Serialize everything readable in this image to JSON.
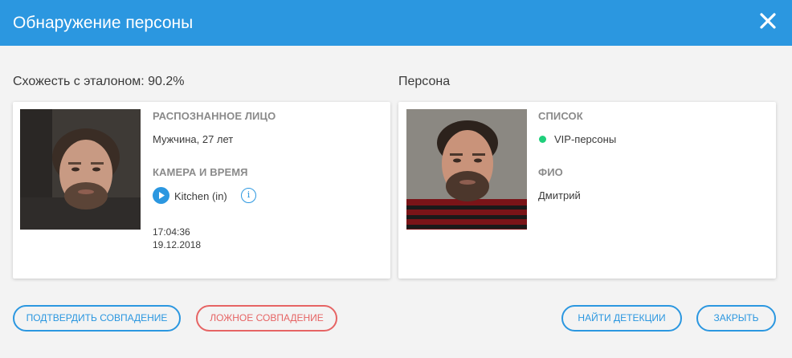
{
  "dialog": {
    "title": "Обнаружение персоны",
    "close_icon": "close-x-icon"
  },
  "left": {
    "heading": "Схожесть с эталоном: 90.2%",
    "recognized_face_label": "РАСПОЗНАННОЕ ЛИЦО",
    "recognized_face_value": "Мужчина, 27 лет",
    "camera_time_label": "КАМЕРА И ВРЕМЯ",
    "camera_name": "Kitchen (in)",
    "time": "17:04:36",
    "date": "19.12.2018"
  },
  "right": {
    "heading": "Персона",
    "list_label": "СПИСОК",
    "list_value": "VIP-персоны",
    "name_label": "ФИО",
    "name_value": "Дмитрий"
  },
  "buttons": {
    "confirm": "ПОДТВЕРДИТЬ СОВПАДЕНИЕ",
    "false_match": "ЛОЖНОЕ СОВПАДЕНИЕ",
    "find_detections": "НАЙТИ ДЕТЕКЦИИ",
    "close": "ЗАКРЫТЬ"
  },
  "colors": {
    "accent": "#2b97e0",
    "danger": "#e66464",
    "status_green": "#1fcf7b"
  }
}
